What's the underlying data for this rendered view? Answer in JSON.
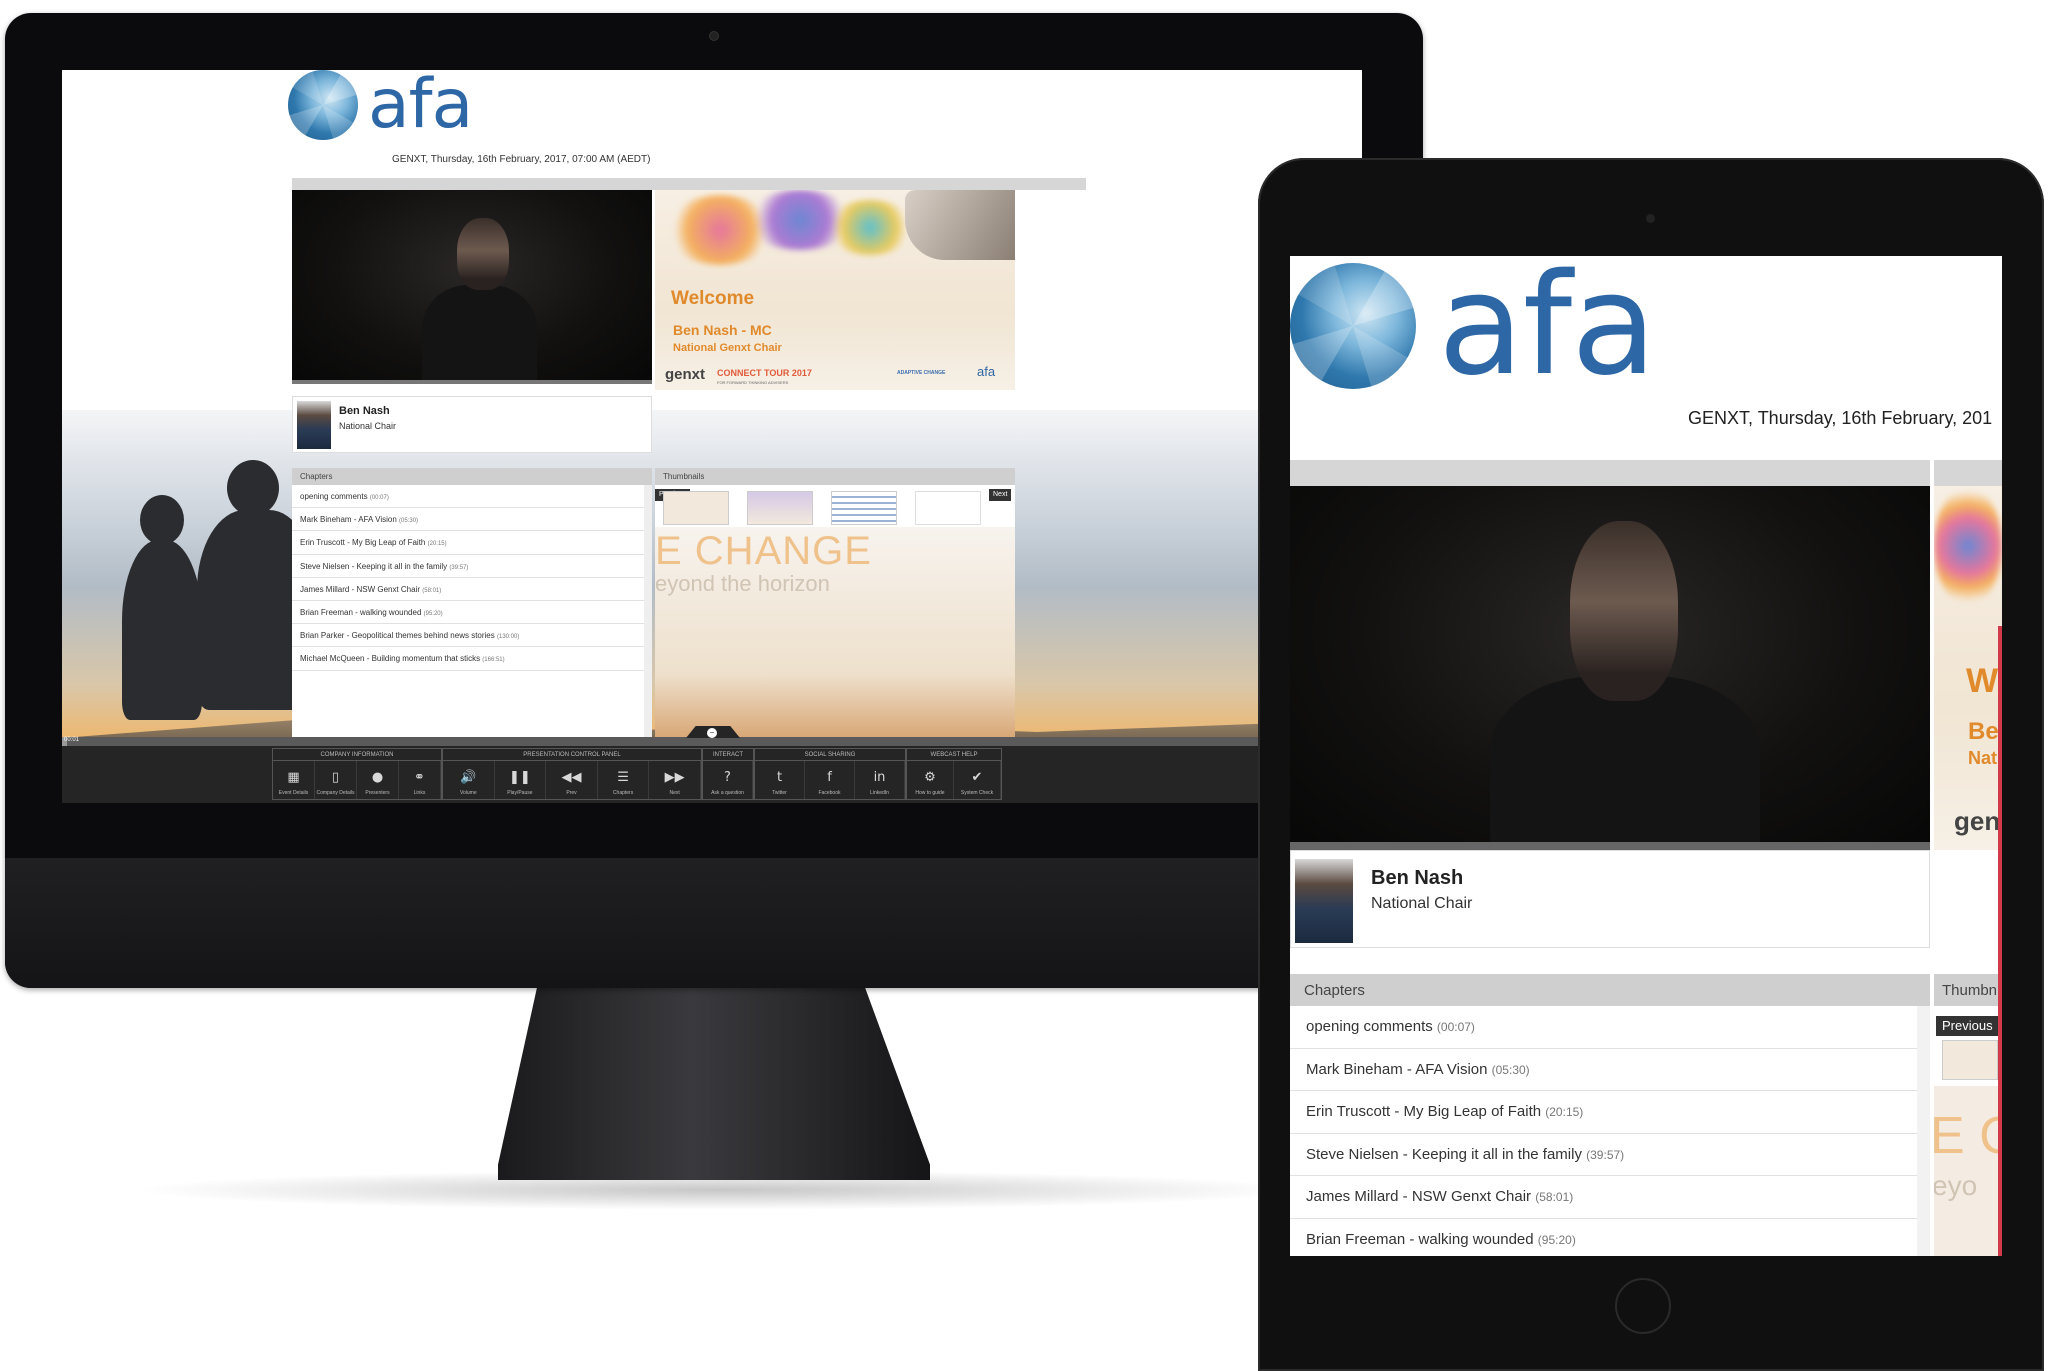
{
  "brand": {
    "logo_text": "afa",
    "accent": "#2e67a6"
  },
  "event": {
    "date_line": "GENXT, Thursday, 16th February, 2017, 07:00 AM (AEDT)",
    "date_line_ipad": "GENXT, Thursday, 16th February, 201"
  },
  "slide": {
    "welcome": "Welcome",
    "mc": "Ben Nash - MC",
    "role": "National Genxt Chair",
    "genxt": "genxt",
    "tour": "CONNECT TOUR 2017",
    "tour_sub": "FOR FORWARD THINKING ADVISERS",
    "partner": "ADAPTIVE CHANGE",
    "partner_logo": "afa"
  },
  "presenter": {
    "name": "Ben Nash",
    "title": "National Chair"
  },
  "chapters": {
    "header": "Chapters",
    "items": [
      {
        "title": "opening comments",
        "time": "(00:07)"
      },
      {
        "title": "Mark Bineham - AFA Vision",
        "time": "(05:30)"
      },
      {
        "title": "Erin Truscott - My Big Leap of Faith",
        "time": "(20:15)"
      },
      {
        "title": "Steve Nielsen - Keeping it all in the family",
        "time": "(39:57)"
      },
      {
        "title": "James Millard - NSW Genxt Chair",
        "time": "(58:01)"
      },
      {
        "title": "Brian Freeman - walking wounded",
        "time": "(95:20)"
      },
      {
        "title": "Brian Parker - Geopolitical themes behind news stories",
        "time": "(130:00)"
      },
      {
        "title": "Michael McQueen - Building momentum that sticks",
        "time": "(166:51)"
      }
    ],
    "ipad_partial": "James Millard - NSW Genxt Chair"
  },
  "thumbnails": {
    "header": "Thumbnails",
    "header_ipad": "Thumbn",
    "prev": "Previous",
    "next": "Next"
  },
  "background_text": {
    "line1": "E CHANGE",
    "line2": "eyond the horizon",
    "ipad1": "E C",
    "ipad2": "eyo"
  },
  "progress": {
    "time": "00:01",
    "fraction": 0.004
  },
  "control_panel": {
    "groups": [
      "COMPANY INFORMATION",
      "PRESENTATION CONTROL PANEL",
      "INTERACT",
      "SOCIAL SHARING",
      "WEBCAST HELP"
    ],
    "buttons": [
      {
        "label": "Event Details",
        "icon": "calendar-icon",
        "glyph": "▦"
      },
      {
        "label": "Company Details",
        "icon": "document-icon",
        "glyph": "▯"
      },
      {
        "label": "Presenters",
        "icon": "person-icon",
        "glyph": "●"
      },
      {
        "label": "Links",
        "icon": "link-icon",
        "glyph": "⚭"
      },
      {
        "label": "Volume",
        "icon": "volume-icon",
        "glyph": "🔊"
      },
      {
        "label": "Play/Pause",
        "icon": "pause-icon",
        "glyph": "❚❚"
      },
      {
        "label": "Prev",
        "icon": "rewind-icon",
        "glyph": "◀◀"
      },
      {
        "label": "Chapters",
        "icon": "list-icon",
        "glyph": "☰"
      },
      {
        "label": "Next",
        "icon": "forward-icon",
        "glyph": "▶▶"
      },
      {
        "label": "Ask a question",
        "icon": "question-icon",
        "glyph": "?"
      },
      {
        "label": "Twitter",
        "icon": "twitter-icon",
        "glyph": "t"
      },
      {
        "label": "Facebook",
        "icon": "facebook-icon",
        "glyph": "f"
      },
      {
        "label": "LinkedIn",
        "icon": "linkedin-icon",
        "glyph": "in"
      },
      {
        "label": "How to guide",
        "icon": "gear-icon",
        "glyph": "⚙"
      },
      {
        "label": "System Check",
        "icon": "check-icon",
        "glyph": "✔"
      }
    ]
  },
  "ipad_slide": {
    "w": "We",
    "b": "Be",
    "n": "Nat",
    "g": "gen"
  }
}
